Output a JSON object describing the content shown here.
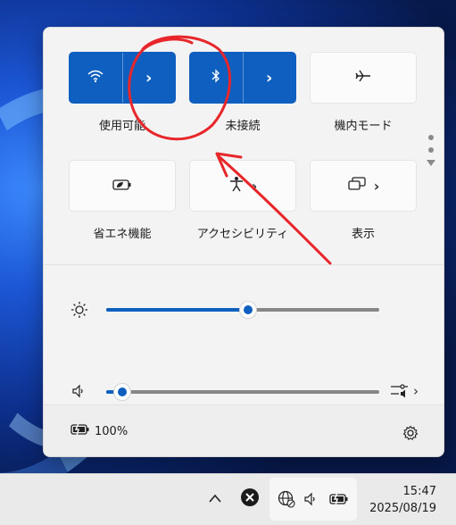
{
  "quick_settings": {
    "tiles": [
      {
        "id": "wifi",
        "label": "使用可能",
        "icon": "wifi-icon",
        "state": "on",
        "split": true
      },
      {
        "id": "bluetooth",
        "label": "未接続",
        "icon": "bluetooth-icon",
        "state": "on",
        "split": true
      },
      {
        "id": "airplane",
        "label": "機内モード",
        "icon": "airplane-icon",
        "state": "off",
        "split": false
      },
      {
        "id": "battery_saver",
        "label": "省エネ機能",
        "icon": "battery-saver-icon",
        "state": "off",
        "split": false
      },
      {
        "id": "accessibility",
        "label": "アクセシビリティ",
        "icon": "accessibility-icon",
        "state": "off",
        "split": false
      },
      {
        "id": "display",
        "label": "表示",
        "icon": "display-cast-icon",
        "state": "off",
        "split": false
      }
    ],
    "brightness": {
      "icon": "brightness-icon",
      "value_fraction": 0.52
    },
    "volume": {
      "icon": "speaker-icon",
      "value_fraction": 0.06
    }
  },
  "footer": {
    "battery_icon": "battery-charging-icon",
    "battery_text": "100%",
    "settings_icon": "gear-icon"
  },
  "taskbar": {
    "time": "15:47",
    "date": "2025/08/19"
  },
  "colors": {
    "accent": "#0e5fbf",
    "annotation": "#e8262a"
  }
}
